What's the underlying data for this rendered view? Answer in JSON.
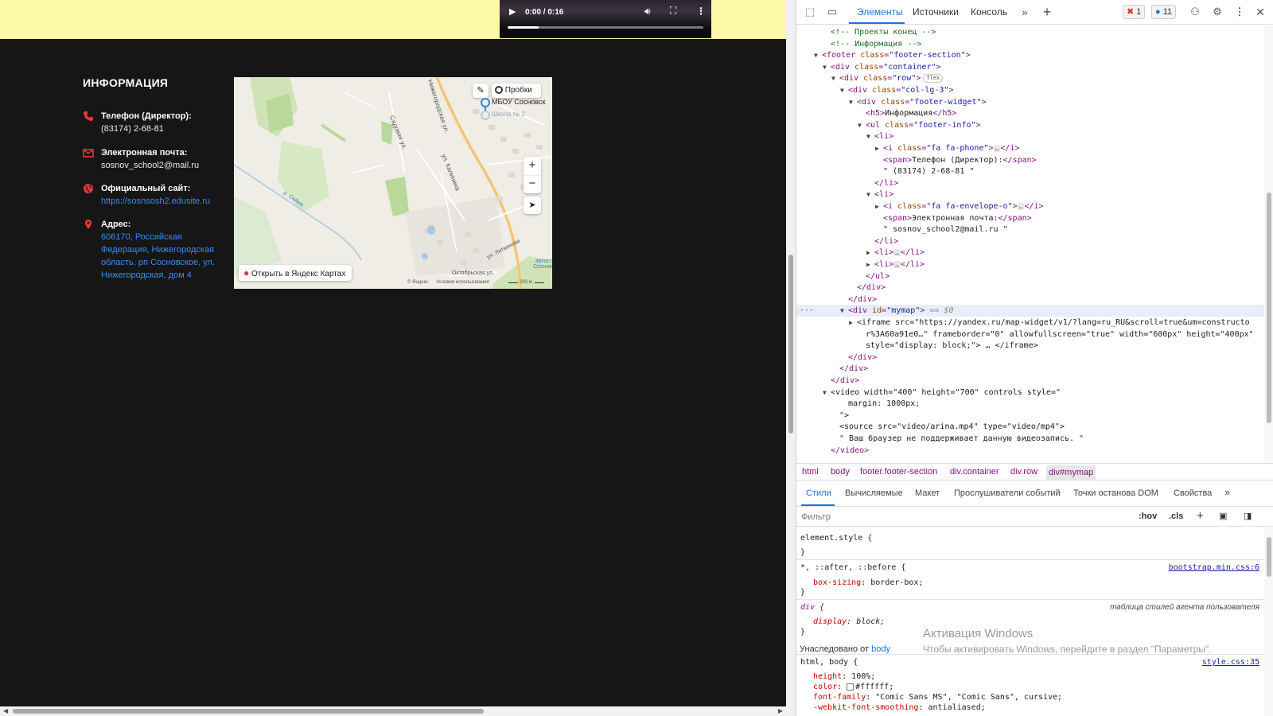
{
  "video": {
    "time": "0:00 / 0:16",
    "progress_fraction": 0.16
  },
  "info": {
    "title": "ИНФОРМАЦИЯ",
    "items": [
      {
        "icon": "phone-icon",
        "label": "Телефон (Директор):",
        "value": "(83174) 2-68-81"
      },
      {
        "icon": "envelope-icon",
        "label": "Электронная почта:",
        "value": "sosnov_school2@mail.ru"
      },
      {
        "icon": "globe-icon",
        "label": "Официальный сайт:",
        "value": "https://sosnsosh2.edusite.ru"
      },
      {
        "icon": "map-marker-icon",
        "label": "Адрес:",
        "value": "606170, Российская Федерация, Нижегородская область, рп Сосновское, ул. Нижегородская, дом 4"
      }
    ],
    "accent_color": "#e53935",
    "link_color": "#3c8cf0"
  },
  "map": {
    "traffic_label": "Пробки",
    "poi_label": "МБОУ Сосновск",
    "poi_sub": "Школа № 2",
    "open_label": "Открыть в Яндекс Картах",
    "streets": [
      "Садовая ул.",
      "Нижегородская ул.",
      "ул. Калинина",
      "ул. Литвинова",
      "Октябрьская ул.",
      "р. Сейма"
    ],
    "footer_brand": "© Яндекс",
    "footer_terms": "Условия использования",
    "scale": "200 м",
    "edge_text": [
      "автост",
      "Соснов"
    ],
    "zoom_in": "+",
    "zoom_out": "−"
  },
  "devtools": {
    "tabs": [
      "Элементы",
      "Источники",
      "Консоль"
    ],
    "errors": "1",
    "messages": "11",
    "dom_lines": [
      {
        "indent": 3,
        "kind": "comment",
        "text": "<!-- Проекты конец -->"
      },
      {
        "indent": 3,
        "kind": "comment",
        "text": "<!-- Информация -->"
      },
      {
        "indent": 2,
        "tw": "▼",
        "open": "footer",
        "attrs": [
          [
            "class",
            "footer-section"
          ]
        ]
      },
      {
        "indent": 3,
        "tw": "▼",
        "open": "div",
        "attrs": [
          [
            "class",
            "container"
          ]
        ]
      },
      {
        "indent": 4,
        "tw": "▼",
        "open": "div",
        "attrs": [
          [
            "class",
            "row"
          ]
        ],
        "flex": "flex"
      },
      {
        "indent": 5,
        "tw": "▼",
        "open": "div",
        "attrs": [
          [
            "class",
            "col-lg-3"
          ]
        ]
      },
      {
        "indent": 6,
        "tw": "▼",
        "open": "div",
        "attrs": [
          [
            "class",
            "footer-widget"
          ]
        ]
      },
      {
        "indent": 7,
        "kind": "inline",
        "tag": "h5",
        "text": "Информация"
      },
      {
        "indent": 7,
        "tw": "▼",
        "open": "ul",
        "attrs": [
          [
            "class",
            "footer-info"
          ]
        ]
      },
      {
        "indent": 8,
        "tw": "▼",
        "open": "li",
        "attrs": []
      },
      {
        "indent": 9,
        "tw": "▶",
        "open": "i",
        "attrs": [
          [
            "class",
            "fa fa-phone"
          ]
        ],
        "collapsed": "i"
      },
      {
        "indent": 9,
        "kind": "inline",
        "tag": "span",
        "text": "Телефон (Директор):"
      },
      {
        "indent": 9,
        "kind": "text",
        "text": "\" (83174) 2-68-81 \""
      },
      {
        "indent": 8,
        "close": "li"
      },
      {
        "indent": 8,
        "tw": "▼",
        "open": "li",
        "attrs": []
      },
      {
        "indent": 9,
        "tw": "▶",
        "open": "i",
        "attrs": [
          [
            "class",
            "fa fa-envelope-o"
          ]
        ],
        "collapsed": "i"
      },
      {
        "indent": 9,
        "kind": "inline",
        "tag": "span",
        "text": "Электронная почта:"
      },
      {
        "indent": 9,
        "kind": "text",
        "text": "\" sosnov_school2@mail.ru \""
      },
      {
        "indent": 8,
        "close": "li"
      },
      {
        "indent": 8,
        "tw": "▶",
        "open": "li",
        "attrs": [],
        "collapsed": "li"
      },
      {
        "indent": 8,
        "tw": "▶",
        "open": "li",
        "attrs": [],
        "collapsed": "li"
      },
      {
        "indent": 7,
        "close": "ul"
      },
      {
        "indent": 6,
        "close": "div"
      },
      {
        "indent": 5,
        "close": "div"
      },
      {
        "indent": 5,
        "tw": "▼",
        "open": "div",
        "attrs": [
          [
            "id",
            "mymap"
          ]
        ],
        "selected": true,
        "suffix": " == $0"
      },
      {
        "indent": 6,
        "tw": "▶",
        "kind": "raw",
        "text": "<iframe src=\"https://yandex.ru/map-widget/v1/?lang=ru_RU&scroll=true&um=constructo"
      },
      {
        "indent": 7,
        "kind": "raw2",
        "text": "r%3A60a91e0…\" frameborder=\"0\" allowfullscreen=\"true\" width=\"600px\" height=\"400px\""
      },
      {
        "indent": 7,
        "kind": "raw2",
        "text": "style=\"display: block;\"> … </iframe>"
      },
      {
        "indent": 5,
        "close": "div"
      },
      {
        "indent": 4,
        "close": "div"
      },
      {
        "indent": 3,
        "close": "div"
      },
      {
        "indent": 3,
        "tw": "▼",
        "kind": "raw",
        "text": "<video width=\"400\" height=\"700\" controls style=\""
      },
      {
        "indent": 5,
        "kind": "raw2",
        "text": "margin: 1000px;"
      },
      {
        "indent": 4,
        "kind": "raw2",
        "text": "\">"
      },
      {
        "indent": 4,
        "kind": "raw",
        "text": "<source src=\"video/arina.mp4\" type=\"video/mp4\">"
      },
      {
        "indent": 4,
        "kind": "text",
        "text": "\" Ваш браузер не поддерживает данную видеозапись. \""
      },
      {
        "indent": 3,
        "close": "video"
      }
    ],
    "breadcrumbs": [
      "html",
      "body",
      "footer.footer-section",
      "div.container",
      "div.row",
      "div#mymap"
    ],
    "subtabs": [
      "Стили",
      "Вычисляемые",
      "Макет",
      "Прослушиватели событий",
      "Точки останова DOM",
      "Свойства"
    ],
    "filter_placeholder": "Фильтр",
    "filter_buttons": [
      ":hov",
      ".cls"
    ],
    "styles": {
      "element_style": "element.style {",
      "rule1_selector": "*, ::after, ::before {",
      "rule1_source": "bootstrap.min.css:6",
      "rule1_prop": "box-sizing",
      "rule1_val": "border-box;",
      "rule2_selector": "div {",
      "rule2_source": "таблица стилей агента пользователя",
      "rule2_prop": "display",
      "rule2_val": "block;",
      "inherited_label": "Унаследовано от",
      "inherited_from": "body",
      "rule3_selector": "html, body {",
      "rule3_source": "style.css:35",
      "rule3_props": [
        [
          "height",
          "100%;"
        ],
        [
          "color",
          "#ffffff;"
        ],
        [
          "font-family",
          "\"Comic Sans MS\", \"Comic Sans\", cursive;"
        ],
        [
          "-webkit-font-smoothing",
          "antialiased;"
        ]
      ],
      "close_brace": "}"
    },
    "watermark_title": "Активация Windows",
    "watermark_sub": "Чтобы активировать Windows, перейдите в раздел \"Параметры\"."
  }
}
